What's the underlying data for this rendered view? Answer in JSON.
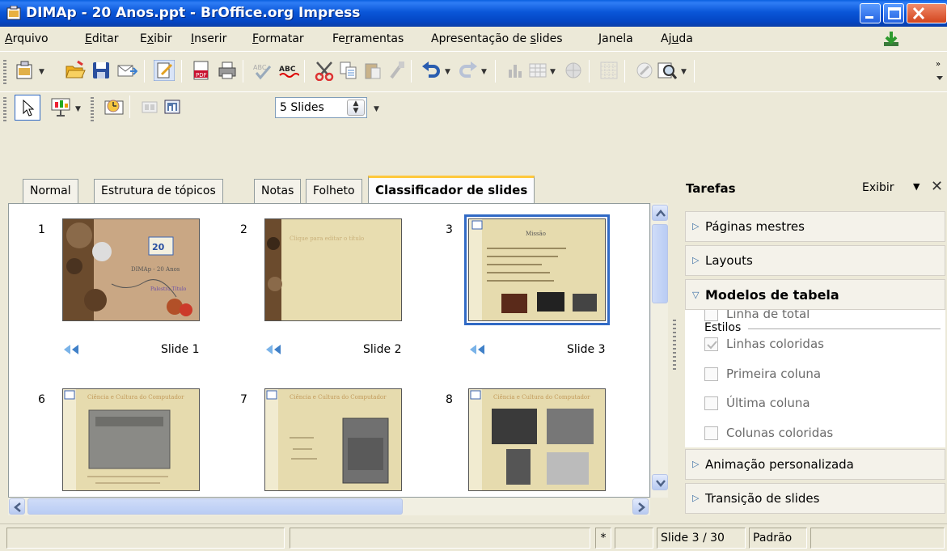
{
  "window": {
    "title": "DIMAp - 20 Anos.ppt - BrOffice.org Impress"
  },
  "menu": [
    {
      "pre": "",
      "key": "A",
      "post": "rquivo"
    },
    {
      "pre": "",
      "key": "E",
      "post": "ditar"
    },
    {
      "pre": "E",
      "key": "x",
      "post": "ibir"
    },
    {
      "pre": "",
      "key": "I",
      "post": "nserir"
    },
    {
      "pre": "",
      "key": "F",
      "post": "ormatar"
    },
    {
      "pre": "Fe",
      "key": "r",
      "post": "ramentas"
    },
    {
      "pre": "Apresentação de ",
      "key": "s",
      "post": "lides"
    },
    {
      "pre": "",
      "key": "J",
      "post": "anela"
    },
    {
      "pre": "Aj",
      "key": "u",
      "post": "da"
    }
  ],
  "toolbar2": {
    "slides_count": "5 Slides"
  },
  "tabs": [
    "Normal",
    "Estrutura de tópicos",
    "Notas",
    "Folheto",
    "Classificador de slides"
  ],
  "active_tab": "Classificador de slides",
  "slides": [
    {
      "num": "1",
      "name": "Slide 1",
      "selected": false
    },
    {
      "num": "2",
      "name": "Slide 2",
      "selected": false
    },
    {
      "num": "3",
      "name": "Slide 3",
      "selected": true
    },
    {
      "num": "6",
      "name": "",
      "selected": false
    },
    {
      "num": "7",
      "name": "",
      "selected": false
    },
    {
      "num": "8",
      "name": "",
      "selected": false
    }
  ],
  "tasks": {
    "title": "Tarefas",
    "view_label": "Exibir",
    "sections": [
      "Páginas mestres",
      "Layouts",
      "Modelos de tabela",
      "Animação personalizada",
      "Transição de slides"
    ],
    "estilos_label": "Estilos",
    "options": [
      {
        "label": "Linha de total",
        "checked": false
      },
      {
        "label": "Linhas coloridas",
        "checked": true
      },
      {
        "label": "Primeira coluna",
        "checked": false
      },
      {
        "label": "Última coluna",
        "checked": false
      },
      {
        "label": "Colunas coloridas",
        "checked": false
      }
    ]
  },
  "status": {
    "modified": "*",
    "slide_pos": "Slide 3 / 30",
    "master": "Padrão"
  },
  "colors": {
    "title_bar": "#0a56d8",
    "selection": "#316ac5",
    "active_tab": "#ffc83c"
  }
}
